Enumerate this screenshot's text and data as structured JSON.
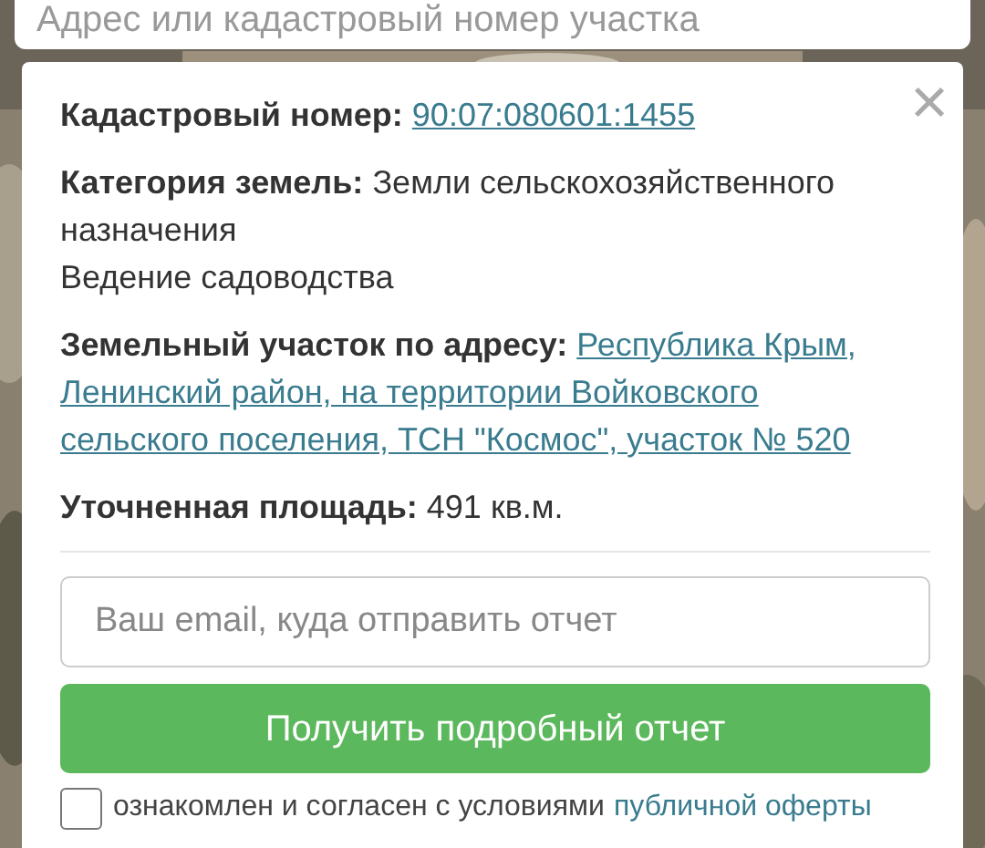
{
  "search": {
    "placeholder": "Адрес или кадастровый номер участка"
  },
  "card": {
    "close": "×",
    "fields": [
      {
        "kind": "link",
        "label": "Кадастровый номер:",
        "lines": [
          "90:07:080601:1455"
        ]
      },
      {
        "kind": "text",
        "label": "Категория земель:",
        "value": "Земли сельскохозяйственного назначения",
        "extra": "Ведение садоводства"
      },
      {
        "kind": "link",
        "label": "Земельный участок по адресу:",
        "lines": [
          "Республика Крым,",
          "Ленинский район, на территории Войковского",
          "сельского поселения, ТСН \"Космос\", участок № 520"
        ]
      },
      {
        "kind": "text",
        "label": "Уточненная площадь:",
        "value": "491 кв.м."
      }
    ],
    "email": {
      "placeholder": "Ваш email, куда отправить отчет"
    },
    "submit": "Получить подробный отчет",
    "agreements": [
      {
        "text": "ознакомлен и согласен с условиями",
        "link": "публичной оферты",
        "checked": false
      }
    ]
  }
}
